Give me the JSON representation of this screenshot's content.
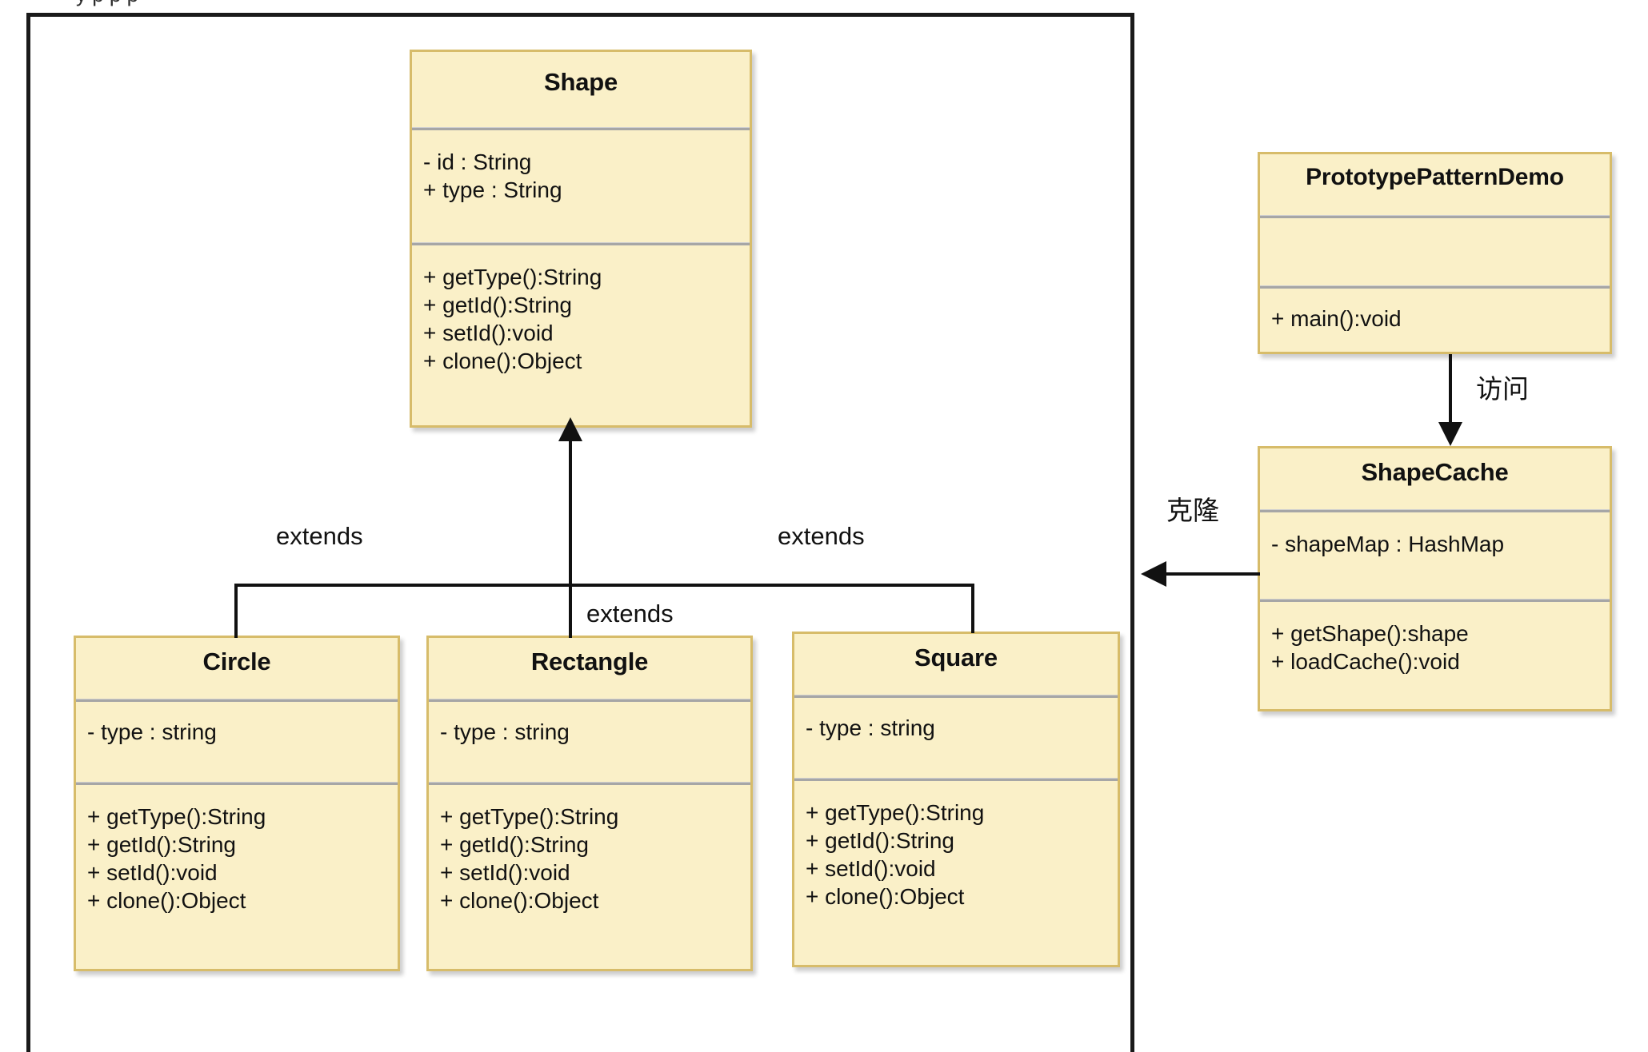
{
  "diagram": {
    "title_sliver": "y p            p                     p",
    "classes": [
      {
        "key": "shape",
        "name": "Shape",
        "attributes": [
          "-  id : String",
          "+ type : String"
        ],
        "methods": [
          "+ getType():String",
          "+ getId():String",
          "+ setId():void",
          "+ clone():Object"
        ]
      },
      {
        "key": "prototype_pattern_demo",
        "name": "PrototypePatternDemo",
        "attributes": [],
        "methods": [
          "+ main():void"
        ]
      },
      {
        "key": "shape_cache",
        "name": "ShapeCache",
        "attributes": [
          "- shapeMap : HashMap"
        ],
        "methods": [
          "+ getShape():shape",
          "+ loadCache():void"
        ]
      },
      {
        "key": "circle",
        "name": "Circle",
        "attributes": [
          "- type : string"
        ],
        "methods": [
          "+ getType():String",
          "+ getId():String",
          "+ setId():void",
          "+ clone():Object"
        ]
      },
      {
        "key": "rectangle",
        "name": "Rectangle",
        "attributes": [
          "- type : string"
        ],
        "methods": [
          "+ getType():String",
          "+ getId():String",
          "+ setId():void",
          "+ clone():Object"
        ]
      },
      {
        "key": "square",
        "name": "Square",
        "attributes": [
          "- type : string"
        ],
        "methods": [
          "+ getType():String",
          "+ getId():String",
          "+ setId():void",
          "+ clone():Object"
        ]
      }
    ],
    "edge_labels": {
      "extends_left": "extends",
      "extends_center": "extends",
      "extends_right": "extends",
      "visit": "访问",
      "clone": "克隆"
    },
    "colors": {
      "box_fill": "#faf0c8",
      "box_border": "#d7bc6a",
      "compartment_separator": "#a6a6a6",
      "connector": "#111111",
      "frame_border": "#1a1a1a",
      "text": "#111111",
      "background": "#ffffff"
    }
  }
}
